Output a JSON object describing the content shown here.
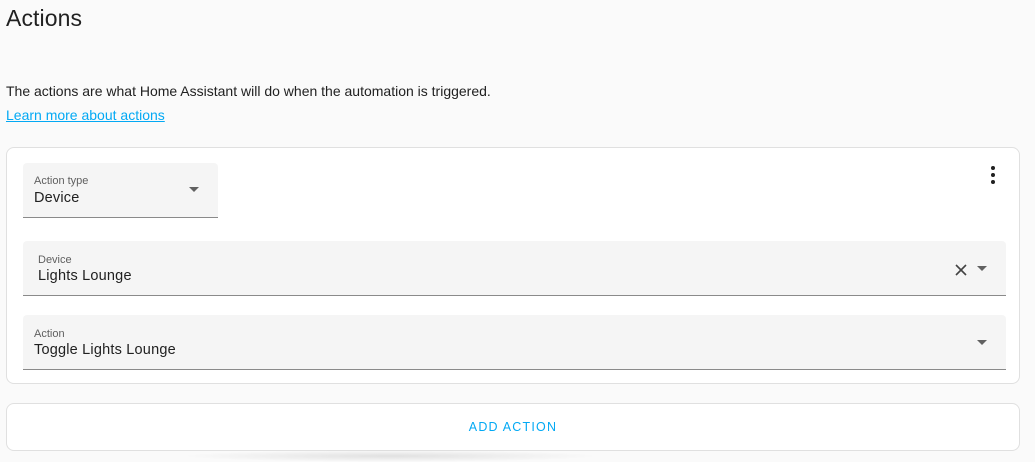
{
  "section": {
    "title": "Actions",
    "description": "The actions are what Home Assistant will do when the automation is triggered.",
    "learn_more": "Learn more about actions"
  },
  "action_card": {
    "action_type": {
      "label": "Action type",
      "value": "Device"
    },
    "device": {
      "label": "Device",
      "value": "Lights Lounge"
    },
    "action": {
      "label": "Action",
      "value": "Toggle Lights Lounge"
    }
  },
  "add_action": {
    "label": "ADD ACTION"
  },
  "colors": {
    "accent": "#03a9f4",
    "field_bg": "#f5f5f5",
    "text": "#212121"
  },
  "icons": {
    "more": "more-vertical-icon",
    "clear": "close-icon",
    "dropdown": "caret-down-icon"
  }
}
